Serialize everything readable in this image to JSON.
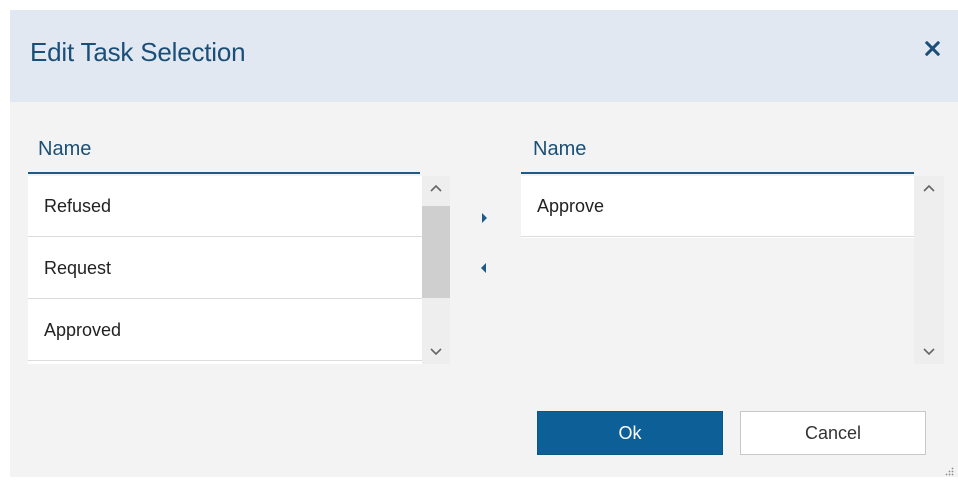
{
  "dialog": {
    "title": "Edit Task Selection",
    "close_icon": "close-icon"
  },
  "available": {
    "header": "Name",
    "items": [
      "Refused",
      "Request",
      "Approved"
    ]
  },
  "selected": {
    "header": "Name",
    "items": [
      "Approve"
    ]
  },
  "move_buttons": {
    "add_icon": "triangle-right-icon",
    "remove_icon": "triangle-left-icon"
  },
  "footer": {
    "ok_label": "Ok",
    "cancel_label": "Cancel"
  },
  "colors": {
    "header_bg": "#e1e8f1",
    "title": "#1b4f77",
    "primary_button": "#0d5f98"
  }
}
